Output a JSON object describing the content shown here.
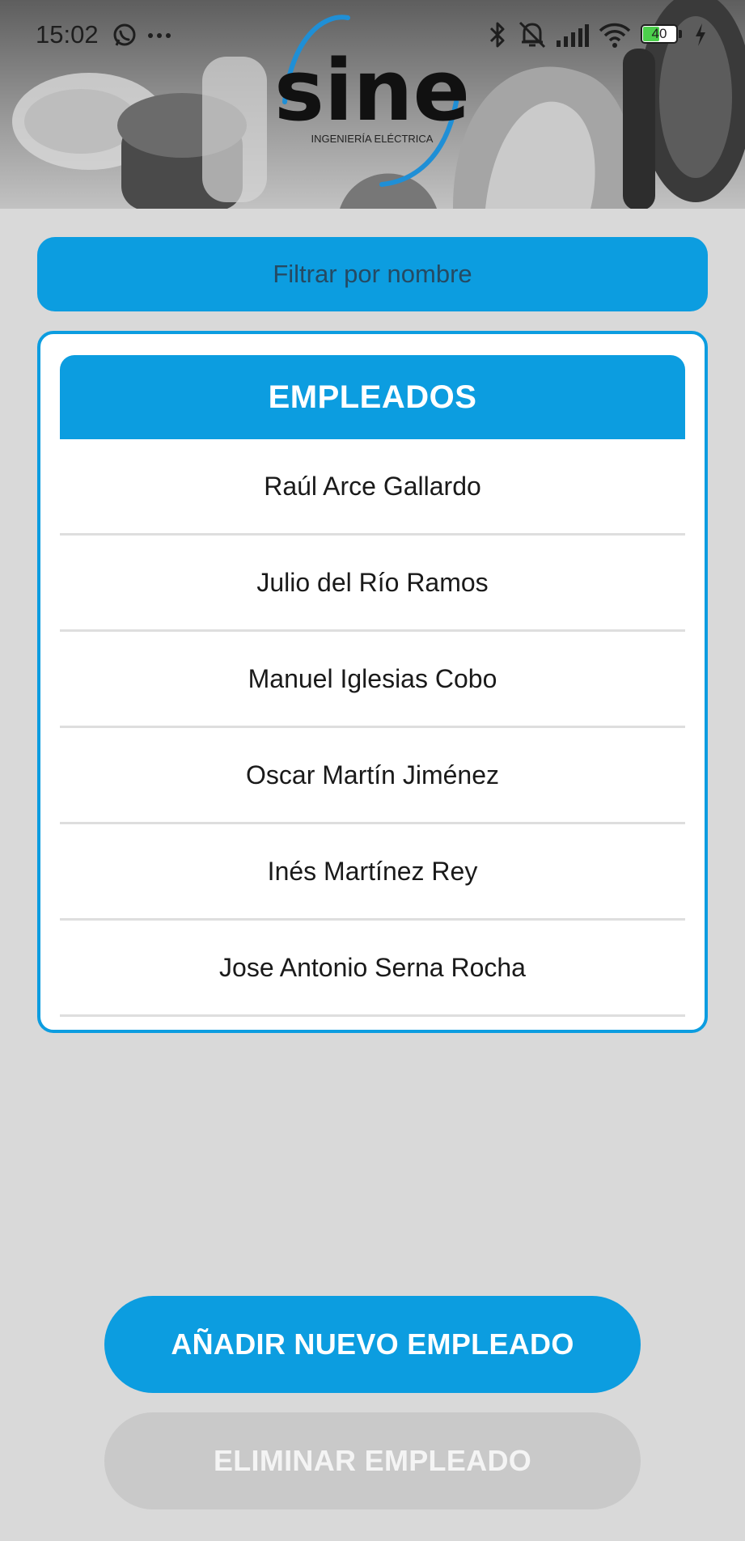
{
  "status_bar": {
    "time": "15:02",
    "battery": "40"
  },
  "logo": {
    "brand": "sine",
    "tagline": "INGENIERÍA ELÉCTRICA"
  },
  "filter": {
    "placeholder": "Filtrar por nombre",
    "value": ""
  },
  "employees": {
    "title": "EMPLEADOS",
    "items": [
      {
        "name": "Raúl Arce Gallardo"
      },
      {
        "name": "Julio del Río Ramos"
      },
      {
        "name": "Manuel Iglesias Cobo"
      },
      {
        "name": "Oscar Martín Jiménez"
      },
      {
        "name": "Inés Martínez Rey"
      },
      {
        "name": "Jose Antonio Serna Rocha"
      }
    ]
  },
  "actions": {
    "add_label": "AÑADIR NUEVO EMPLEADO",
    "delete_label": "ELIMINAR EMPLEADO"
  },
  "colors": {
    "accent": "#0c9de0",
    "background": "#d9d9d9",
    "disabled": "#c9c9c9"
  }
}
